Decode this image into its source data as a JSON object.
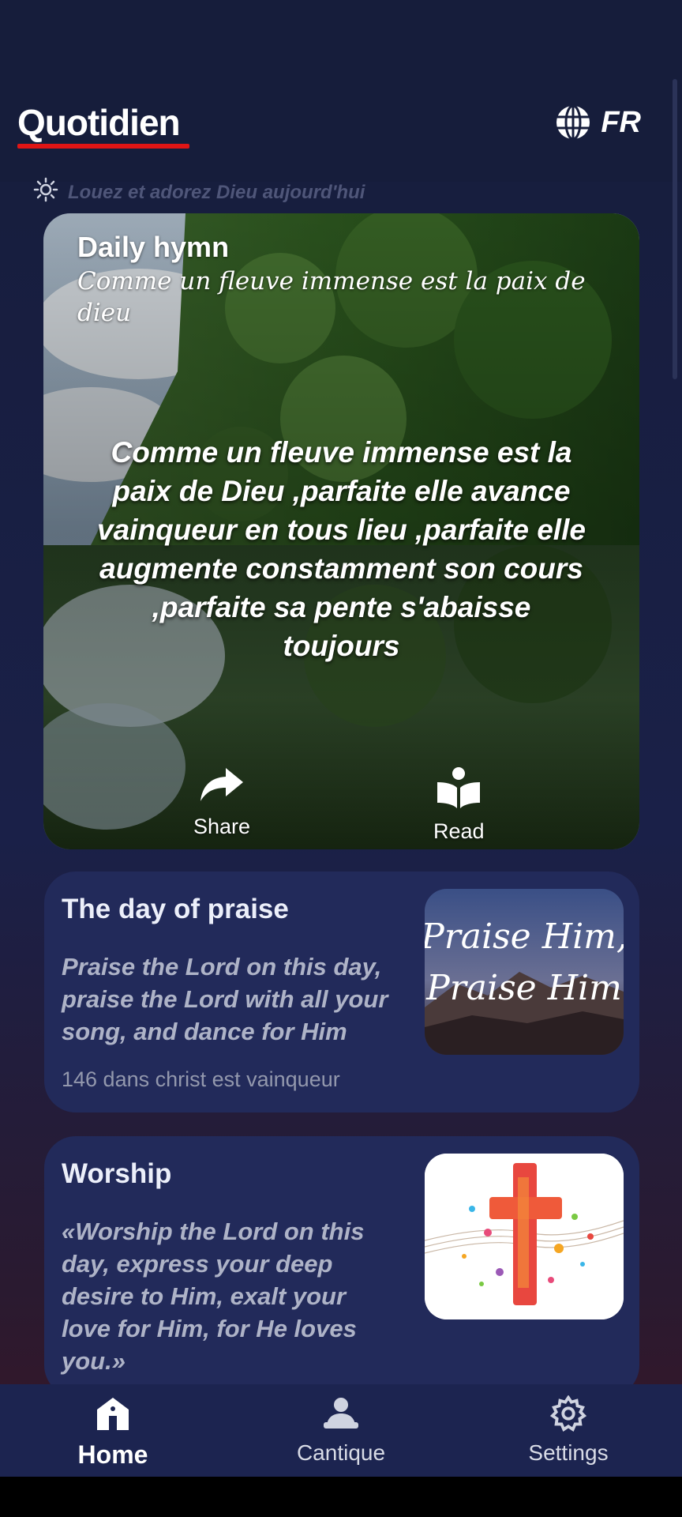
{
  "app": {
    "title": "Quotidien",
    "language": "FR",
    "tagline": "Louez et adorez Dieu aujourd'hui"
  },
  "hero": {
    "title": "Daily hymn",
    "subtitle": "Comme un fleuve immense est la paix de dieu",
    "text": "Comme un fleuve immense est la paix de Dieu ,parfaite elle avance vainqueur en tous lieu ,parfaite elle augmente constamment son cours ,parfaite sa pente s'abaisse toujours",
    "share_label": "Share",
    "read_label": "Read"
  },
  "cards": [
    {
      "title": "The day of praise",
      "text": "Praise the Lord on this day, praise the Lord with all your song, and dance for Him",
      "meta": "146 dans christ est vainqueur",
      "image_text_1": "Praise Him,",
      "image_text_2": "Praise Him"
    },
    {
      "title": "Worship",
      "text": "«Worship the Lord on this day, express your deep desire to Him, exalt your love for Him, for He loves you.»"
    }
  ],
  "nav": {
    "items": [
      {
        "label": "Home",
        "icon": "home-icon",
        "active": true
      },
      {
        "label": "Cantique",
        "icon": "cantique-icon",
        "active": false
      },
      {
        "label": "Settings",
        "icon": "gear-icon",
        "active": false
      }
    ]
  },
  "colors": {
    "background": "#161d3b",
    "card": "#222a5a",
    "accent": "#e01515",
    "nav": "#1c2450"
  }
}
